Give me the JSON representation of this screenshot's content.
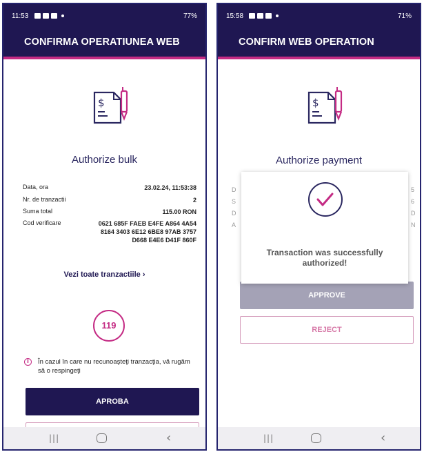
{
  "left": {
    "status": {
      "time": "11:53",
      "battery": "77%"
    },
    "header_title": "CONFIRMA OPERATIUNEA WEB",
    "heading": "Authorize bulk",
    "details": [
      {
        "label": "Data, ora",
        "value": "23.02.24, 11:53:38"
      },
      {
        "label": "Nr. de tranzactii",
        "value": "2"
      },
      {
        "label": "Suma total",
        "value": "115.00 RON"
      },
      {
        "label": "Cod verificare",
        "value": "0621 685F FAEB E4FE A864 4A54 8164 3403 6E12 6BE8 97AB 3757 D668 E4E6 D41F 860F"
      }
    ],
    "see_all": "Vezi toate tranzactiile",
    "timer": "119",
    "info": "În cazul în care nu recunoaşteţi tranzacţia, vă rugăm să o respingeţi",
    "approve_label": "APROBA"
  },
  "right": {
    "status": {
      "time": "15:58",
      "battery": "71%"
    },
    "header_title": "CONFIRM WEB OPERATION",
    "heading": "Authorize payment",
    "modal_text": "Transaction was successfully authorized!",
    "approve_label": "APPROVE",
    "reject_label": "REJECT",
    "ghost_labels": [
      "D",
      "S",
      "D",
      "A"
    ],
    "ghost_values": [
      "5",
      "6",
      "D",
      "N"
    ]
  },
  "colors": {
    "navy": "#1f1752",
    "magenta": "#c42b84"
  },
  "icons": {
    "document": "document-pen-icon",
    "check": "check-circle-icon"
  }
}
